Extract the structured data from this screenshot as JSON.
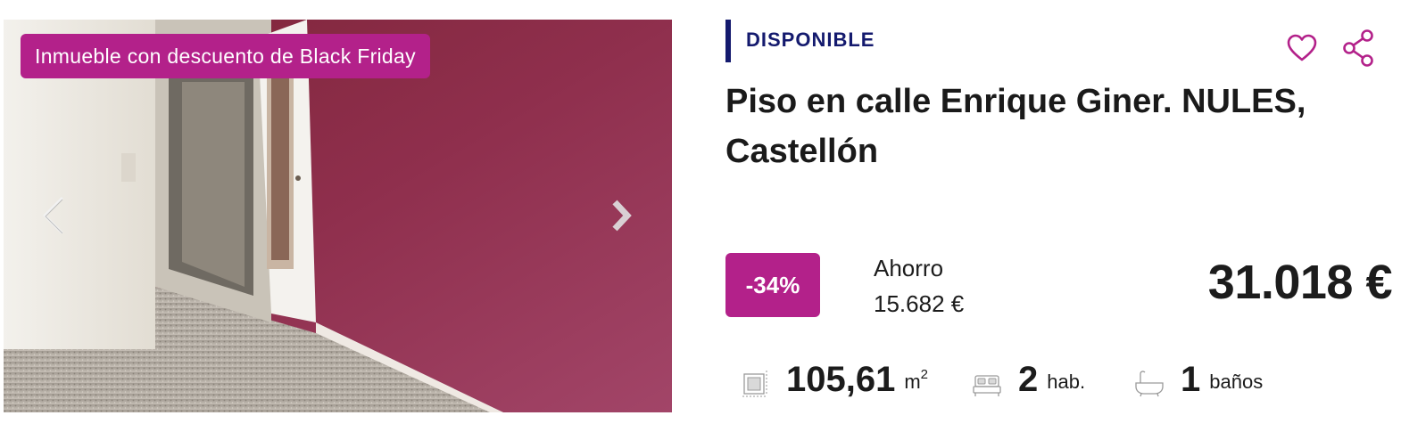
{
  "listing": {
    "promo_badge": "Inmueble con descuento de Black Friday",
    "status": "DISPONIBLE",
    "title": "Piso en calle Enrique Giner. NULES, Castellón",
    "discount": "-34%",
    "savings_label": "Ahorro",
    "savings_value": "15.682 €",
    "price": "31.018 €",
    "features": {
      "area_value": "105,61",
      "area_unit": "m",
      "area_exp": "2",
      "rooms_value": "2",
      "rooms_unit": "hab.",
      "baths_value": "1",
      "baths_unit": "baños"
    }
  },
  "icons": {
    "prev": "chevron-left-icon",
    "next": "chevron-right-icon",
    "favorite": "heart-icon",
    "share": "share-icon",
    "area": "floor-plan-icon",
    "rooms": "bed-icon",
    "baths": "bathtub-icon"
  },
  "colors": {
    "accent": "#b3218a",
    "status_navy": "#141a6e",
    "text": "#1c1c1c"
  }
}
